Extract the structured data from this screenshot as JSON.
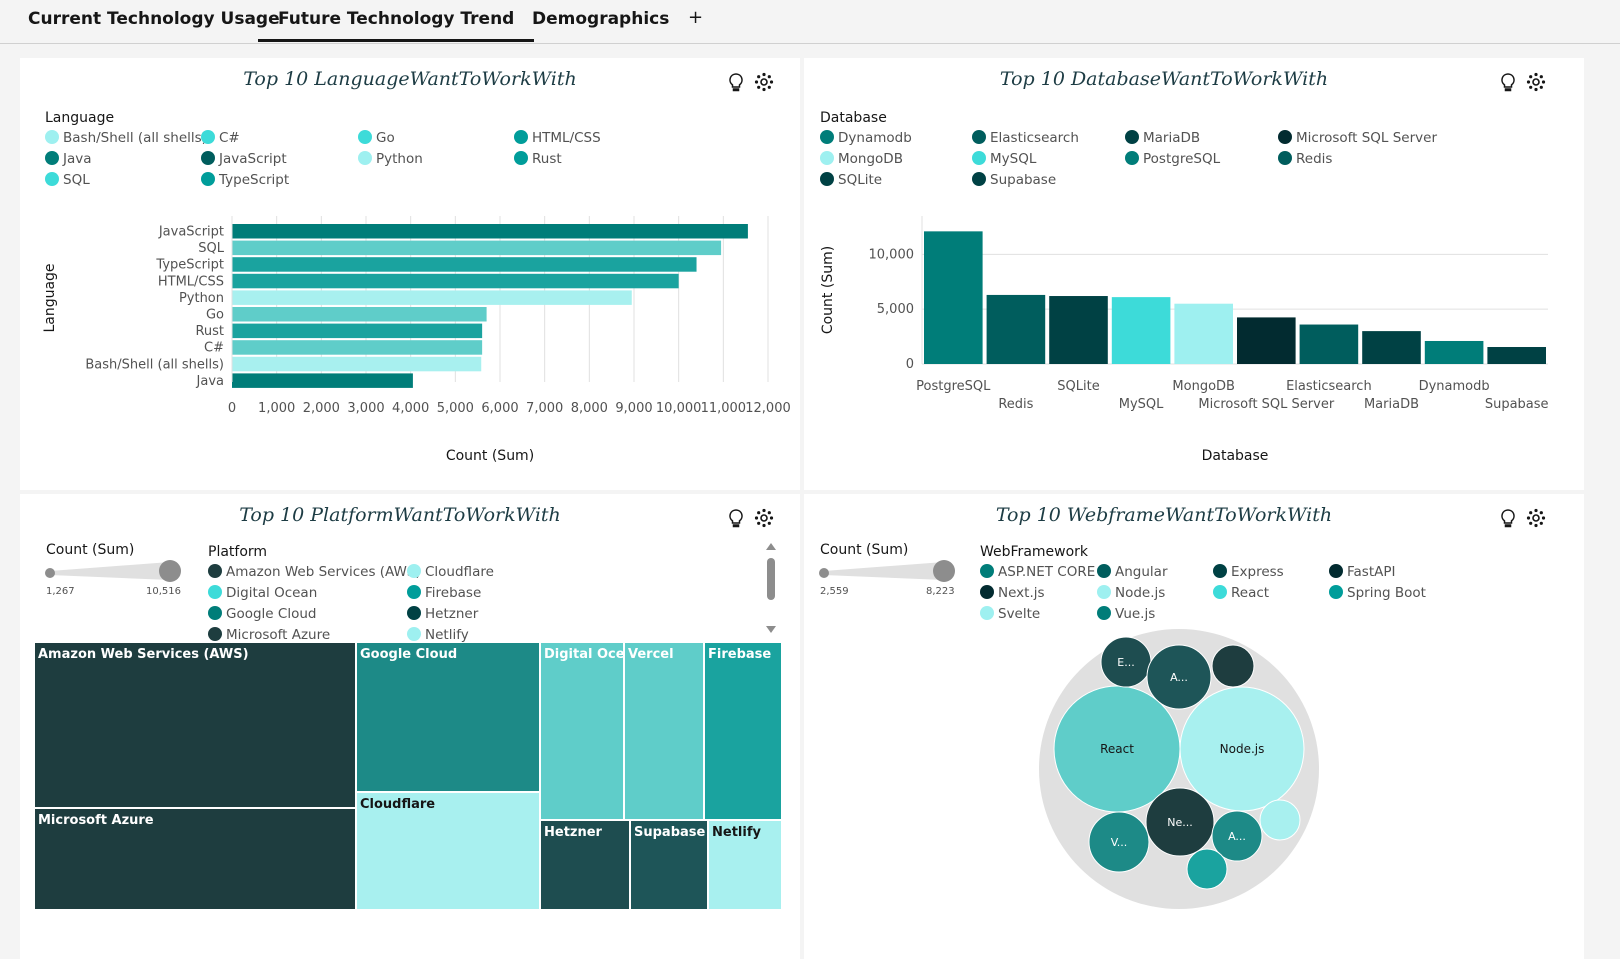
{
  "tabs": [
    {
      "label": "Current Technology Usage"
    },
    {
      "label": "Future Technology Trend"
    },
    {
      "label": "Demographics"
    }
  ],
  "tab_add": "+",
  "colors": {
    "teal_dark": "#005d5d",
    "teal_darker": "#004144",
    "teal_darkest": "#022b30",
    "teal": "#007d79",
    "teal_mid": "#009d9a",
    "teal_light": "#3ddbd9",
    "teal_pale": "#9ef0f0",
    "treemap_dark": "#1e3d3f"
  },
  "panels": {
    "language": {
      "title": "Top 10 LanguageWantToWorkWith",
      "legend_title": "Language",
      "legend": [
        {
          "label": "Bash/Shell (all shells)",
          "color": "#9ef0f0"
        },
        {
          "label": "C#",
          "color": "#3ddbd9"
        },
        {
          "label": "Go",
          "color": "#3ddbd9"
        },
        {
          "label": "HTML/CSS",
          "color": "#009d9a"
        },
        {
          "label": "Java",
          "color": "#007d79"
        },
        {
          "label": "JavaScript",
          "color": "#005d5d"
        },
        {
          "label": "Python",
          "color": "#9ef0f0"
        },
        {
          "label": "Rust",
          "color": "#009d9a"
        },
        {
          "label": "SQL",
          "color": "#3ddbd9"
        },
        {
          "label": "TypeScript",
          "color": "#009d9a"
        }
      ]
    },
    "database": {
      "title": "Top 10 DatabaseWantToWorkWith",
      "legend_title": "Database",
      "legend": [
        {
          "label": "Dynamodb",
          "color": "#007d79"
        },
        {
          "label": "Elasticsearch",
          "color": "#005d5d"
        },
        {
          "label": "MariaDB",
          "color": "#004144"
        },
        {
          "label": "Microsoft SQL Server",
          "color": "#022b30"
        },
        {
          "label": "MongoDB",
          "color": "#9ef0f0"
        },
        {
          "label": "MySQL",
          "color": "#3ddbd9"
        },
        {
          "label": "PostgreSQL",
          "color": "#007d79"
        },
        {
          "label": "Redis",
          "color": "#005d5d"
        },
        {
          "label": "SQLite",
          "color": "#004144"
        },
        {
          "label": "Supabase",
          "color": "#004144"
        }
      ]
    },
    "platform": {
      "title": "Top 10 PlatformWantToWorkWith",
      "slider_label": "Count (Sum)",
      "slider_min": "1,267",
      "slider_max": "10,516",
      "legend_title": "Platform",
      "legend": [
        {
          "label": "Amazon Web Services (AWS)",
          "color": "#1e3d3f"
        },
        {
          "label": "Cloudflare",
          "color": "#9ef0f0"
        },
        {
          "label": "Digital Ocean",
          "color": "#3ddbd9"
        },
        {
          "label": "Firebase",
          "color": "#009d9a"
        },
        {
          "label": "Google Cloud",
          "color": "#007d79"
        },
        {
          "label": "Hetzner",
          "color": "#004144"
        },
        {
          "label": "Microsoft Azure",
          "color": "#1e3d3f"
        },
        {
          "label": "Netlify",
          "color": "#9ef0f0"
        }
      ],
      "treemap": [
        {
          "label": "Amazon Web Services (AWS)",
          "color": "#1e3d3f"
        },
        {
          "label": "Microsoft Azure",
          "color": "#1e3d3f"
        },
        {
          "label": "Google Cloud",
          "color": "#1d8a87"
        },
        {
          "label": "Cloudflare",
          "color": "#a8f0ef"
        },
        {
          "label": "Digital Oce...",
          "color": "#5fcdc9"
        },
        {
          "label": "Vercel",
          "color": "#5fcdc9"
        },
        {
          "label": "Firebase",
          "color": "#1aa39f"
        },
        {
          "label": "Hetzner",
          "color": "#1e4d50"
        },
        {
          "label": "Supabase",
          "color": "#1e5558"
        },
        {
          "label": "Netlify",
          "color": "#a8f0ef"
        }
      ]
    },
    "webframe": {
      "title": "Top 10 WebframeWantToWorkWith",
      "slider_label": "Count (Sum)",
      "slider_min": "2,559",
      "slider_max": "8,223",
      "legend_title": "WebFramework",
      "legend": [
        {
          "label": "ASP.NET CORE",
          "color": "#007d79"
        },
        {
          "label": "Angular",
          "color": "#005d5d"
        },
        {
          "label": "Express",
          "color": "#004144"
        },
        {
          "label": "FastAPI",
          "color": "#022b30"
        },
        {
          "label": "Next.js",
          "color": "#022b30"
        },
        {
          "label": "Node.js",
          "color": "#9ef0f0"
        },
        {
          "label": "React",
          "color": "#3ddbd9"
        },
        {
          "label": "Spring Boot",
          "color": "#009d9a"
        },
        {
          "label": "Svelte",
          "color": "#9ef0f0"
        },
        {
          "label": "Vue.js",
          "color": "#007d79"
        }
      ],
      "bubbles": [
        {
          "label": "React",
          "color": "#5fcdc9"
        },
        {
          "label": "Node.js",
          "color": "#a8f0ef"
        },
        {
          "label": "Ne...",
          "color": "#1e3d3f"
        },
        {
          "label": "V...",
          "color": "#1d8a87"
        },
        {
          "label": "A...",
          "color": "#1d8a87"
        },
        {
          "label": "E...",
          "color": "#1e4d50"
        },
        {
          "label": "A...",
          "color": "#1e5558"
        },
        {
          "label": "",
          "color": "#1e3d3f"
        },
        {
          "label": "",
          "color": "#a8f0ef"
        },
        {
          "label": "",
          "color": "#1aa39f"
        }
      ]
    }
  },
  "chart_data": [
    {
      "type": "bar",
      "orientation": "horizontal",
      "title": "Top 10 LanguageWantToWorkWith",
      "xlabel": "Count (Sum)",
      "ylabel": "Language",
      "categories": [
        "JavaScript",
        "SQL",
        "TypeScript",
        "HTML/CSS",
        "Python",
        "Go",
        "Rust",
        "C#",
        "Bash/Shell (all shells)",
        "Java"
      ],
      "values": [
        11550,
        10950,
        10400,
        10000,
        8950,
        5700,
        5600,
        5600,
        5580,
        4050
      ],
      "colors": [
        "#007d79",
        "#5fcdc9",
        "#1aa39f",
        "#1aa39f",
        "#a8f0ef",
        "#5fcdc9",
        "#1aa39f",
        "#5fcdc9",
        "#a8f0ef",
        "#007d79"
      ],
      "xlim": [
        0,
        12000
      ],
      "xticks": [
        "0",
        "1,000",
        "2,000",
        "3,000",
        "4,000",
        "5,000",
        "6,000",
        "7,000",
        "8,000",
        "9,000",
        "10,000",
        "11,000",
        "12,000"
      ]
    },
    {
      "type": "bar",
      "orientation": "vertical",
      "title": "Top 10 DatabaseWantToWorkWith",
      "xlabel": "Database",
      "ylabel": "Count (Sum)",
      "categories": [
        "PostgreSQL",
        "Redis",
        "SQLite",
        "MySQL",
        "MongoDB",
        "Microsoft SQL Server",
        "Elasticsearch",
        "MariaDB",
        "Dynamodb",
        "Supabase"
      ],
      "values": [
        12100,
        6300,
        6200,
        6100,
        5500,
        4250,
        3600,
        3000,
        2100,
        1550
      ],
      "colors": [
        "#007d79",
        "#005d5d",
        "#004144",
        "#3ddbd9",
        "#9ef0f0",
        "#022b30",
        "#005d5d",
        "#004144",
        "#007d79",
        "#004144"
      ],
      "ylim": [
        0,
        13500
      ],
      "yticks": [
        {
          "v": 0,
          "label": "0"
        },
        {
          "v": 5000,
          "label": "5,000"
        },
        {
          "v": 10000,
          "label": "10,000"
        }
      ]
    },
    {
      "type": "treemap",
      "title": "Top 10 PlatformWantToWorkWith",
      "labels": [
        "Amazon Web Services (AWS)",
        "Microsoft Azure",
        "Google Cloud",
        "Cloudflare",
        "Digital Ocean",
        "Vercel",
        "Firebase",
        "Hetzner",
        "Supabase",
        "Netlify"
      ]
    },
    {
      "type": "bubble",
      "title": "Top 10 WebframeWantToWorkWith",
      "labels": [
        "React",
        "Node.js",
        "Next.js",
        "Vue.js",
        "Angular",
        "Express",
        "ASP.NET CORE",
        "FastAPI",
        "Svelte",
        "Spring Boot"
      ]
    }
  ]
}
